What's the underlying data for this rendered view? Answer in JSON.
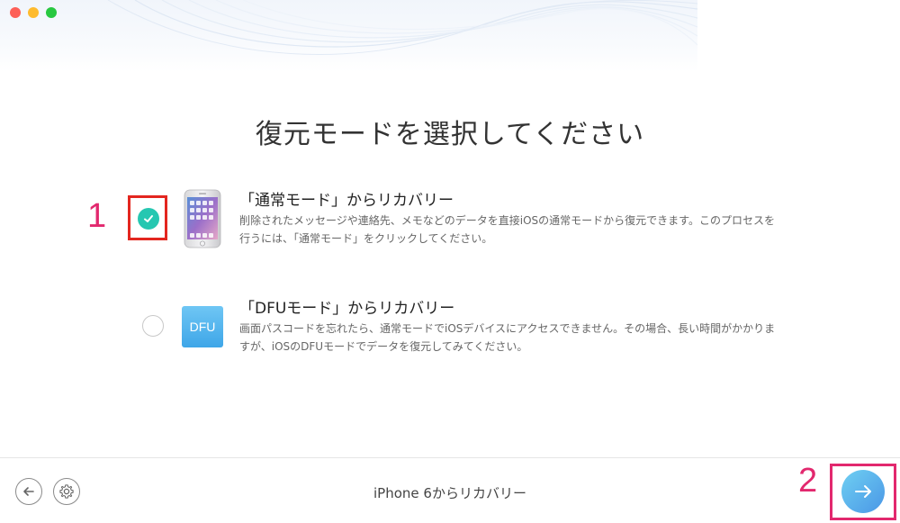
{
  "window": {
    "controls": [
      {
        "name": "close",
        "color": "#fd5f57"
      },
      {
        "name": "minimize",
        "color": "#febb2e"
      },
      {
        "name": "zoom",
        "color": "#28c840"
      }
    ]
  },
  "page": {
    "title": "復元モードを選択してください"
  },
  "annotations": {
    "step1": "1",
    "step2": "2",
    "color": "#e2286e"
  },
  "options": [
    {
      "title": "「通常モード」からリカバリー",
      "description": "削除されたメッセージや連絡先、メモなどのデータを直接iOSの通常モードから復元できます。このプロセスを行うには、「通常モード」をクリックしてください。",
      "selected": true,
      "icon": "iphone-icon"
    },
    {
      "title": "「DFUモード」からリカバリー",
      "description": "画面パスコードを忘れたら、通常モードでiOSデバイスにアクセスできません。その場合、長い時間がかかりますが、iOSのDFUモードでデータを復元してみてください。",
      "selected": false,
      "icon": "dfu-icon",
      "icon_text": "DFU"
    }
  ],
  "footer": {
    "device_label": "iPhone 6からリカバリー",
    "back_icon": "arrow-left-icon",
    "settings_icon": "gear-icon",
    "next_icon": "arrow-right-icon"
  },
  "colors": {
    "accent_teal": "#26c7b1",
    "highlight_red": "#e3261f",
    "next_gradient_start": "#6fd0f2",
    "next_gradient_end": "#4a96e6"
  }
}
